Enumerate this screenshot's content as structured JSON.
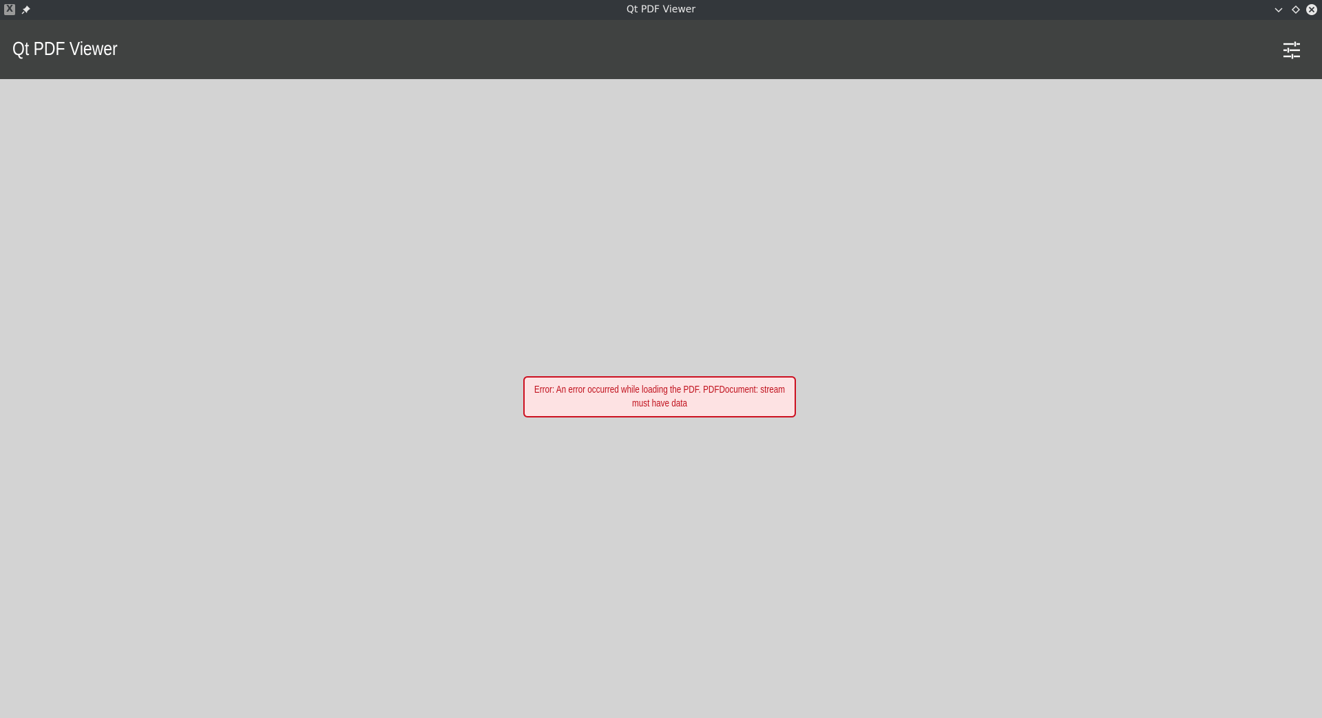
{
  "window": {
    "title": "Qt PDF Viewer",
    "app_icon_glyph": "X",
    "icons": {
      "app": "x-app-icon",
      "pin": "pin-icon",
      "minimize": "chevron-down-icon",
      "maximize": "diamond-icon",
      "close": "close-icon"
    }
  },
  "header": {
    "title": "Qt PDF Viewer",
    "settings_icon": "sliders-icon"
  },
  "main": {
    "error_message": "Error: An error occurred while loading the PDF. PDFDocument: stream must have data"
  },
  "colors": {
    "titlebar_bg": "#33373b",
    "header_bg": "#404241",
    "content_bg": "#d3d3d3",
    "error_border": "#cc1020",
    "error_bg": "#fde2e3",
    "error_text": "#c0101c"
  }
}
